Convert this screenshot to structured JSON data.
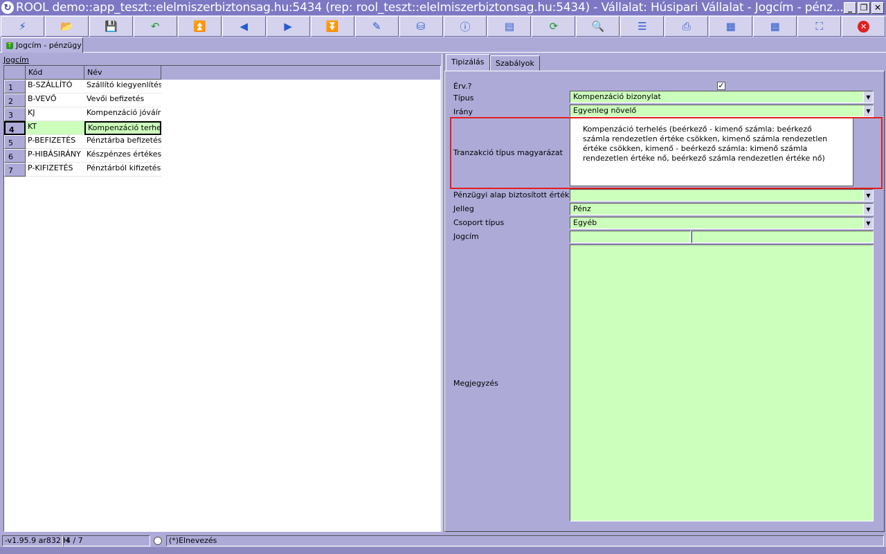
{
  "window": {
    "title": "ROOL demo::app_teszt::elelmiszerbiztonsag.hu:5434 (rep: rool_teszt::elelmiszerbiztonsag.hu:5434) - Vállalat: Húsipari Vállalat - Jogcím - pénz...",
    "min_label": "_",
    "max_label": "❐",
    "close_label": "✕"
  },
  "toolbar": [
    {
      "name": "run-icon",
      "glyph": "⚡"
    },
    {
      "name": "open-icon",
      "glyph": "📂"
    },
    {
      "name": "save-icon",
      "glyph": "💾"
    },
    {
      "name": "undo-icon",
      "glyph": "↶"
    },
    {
      "name": "first-icon",
      "glyph": "⏫"
    },
    {
      "name": "prev-icon",
      "glyph": "◀"
    },
    {
      "name": "next-icon",
      "glyph": "▶"
    },
    {
      "name": "last-icon",
      "glyph": "⏬"
    },
    {
      "name": "edit-icon",
      "glyph": "✎"
    },
    {
      "name": "database-icon",
      "glyph": "⛁"
    },
    {
      "name": "info-icon",
      "glyph": "ⓘ"
    },
    {
      "name": "layout-icon",
      "glyph": "▤"
    },
    {
      "name": "refresh-icon",
      "glyph": "⟳"
    },
    {
      "name": "search-icon",
      "glyph": "🔍"
    },
    {
      "name": "columns-icon",
      "glyph": "☰"
    },
    {
      "name": "print-icon",
      "glyph": "⎙"
    },
    {
      "name": "export-grid-icon",
      "glyph": "▦"
    },
    {
      "name": "grid-icon",
      "glyph": "▦"
    },
    {
      "name": "fullscreen-icon",
      "glyph": "⛶"
    },
    {
      "name": "close-icon",
      "glyph": "✕"
    }
  ],
  "doc_tab": {
    "label": "Jogcím - pénzügy"
  },
  "left": {
    "title": "Jogcím",
    "columns": [
      "Kód",
      "Név"
    ],
    "rows": [
      {
        "num": "1",
        "kod": "B-SZÁLLÍTÓ",
        "nev": "Szállító kiegyenlítése"
      },
      {
        "num": "2",
        "kod": "B-VEVŐ",
        "nev": "Vevői befizetés"
      },
      {
        "num": "3",
        "kod": "KJ",
        "nev": "Kompenzáció jóváírás"
      },
      {
        "num": "4",
        "kod": "KT",
        "nev": "Kompenzáció terhelés"
      },
      {
        "num": "5",
        "kod": "P-BEFIZETÉS",
        "nev": "Pénztárba befizetés"
      },
      {
        "num": "6",
        "kod": "P-HIBÁSIRÁNY",
        "nev": "Készpénzes értékesíté"
      },
      {
        "num": "7",
        "kod": "P-KIFIZETÉS",
        "nev": "Pénztárból kifizetés"
      }
    ]
  },
  "right": {
    "tabs": [
      "Tipizálás",
      "Szabályok"
    ],
    "erv_label": "Érv.?",
    "erv_check": "✓",
    "tipus_label": "Típus",
    "tipus_value": "Kompenzáció bizonylat",
    "irany_label": "Irány",
    "irany_value": "Egyenleg növelő",
    "tranz_label": "Tranzakció típus magyarázat",
    "tranz_value": "Kompenzáció terhelés (beérkező - kimenő számla: beérkező számla rendezetlen értéke csökken, kimenő számla rendezetlen értéke csökken, kimenő - beérkező számla: kimenő számla rendezetlen értéke nő, beérkező számla rendezetlen értéke nő)",
    "penz_label": "Pénzügyi alap biztosított érték irány",
    "penz_value": "",
    "jelleg_label": "Jelleg",
    "jelleg_value": "Pénz",
    "csoport_label": "Csoport típus",
    "csoport_value": "Egyéb",
    "jogcim_label": "Jogcím",
    "jogcim_value1": "",
    "jogcim_value2": "",
    "megj_label": "Megjegyzés",
    "dropdown_glyph": "▼"
  },
  "status": {
    "version": "-v1.95.9 ar832 H",
    "position": "4 / 7",
    "field": "(*)Elnevezés"
  }
}
